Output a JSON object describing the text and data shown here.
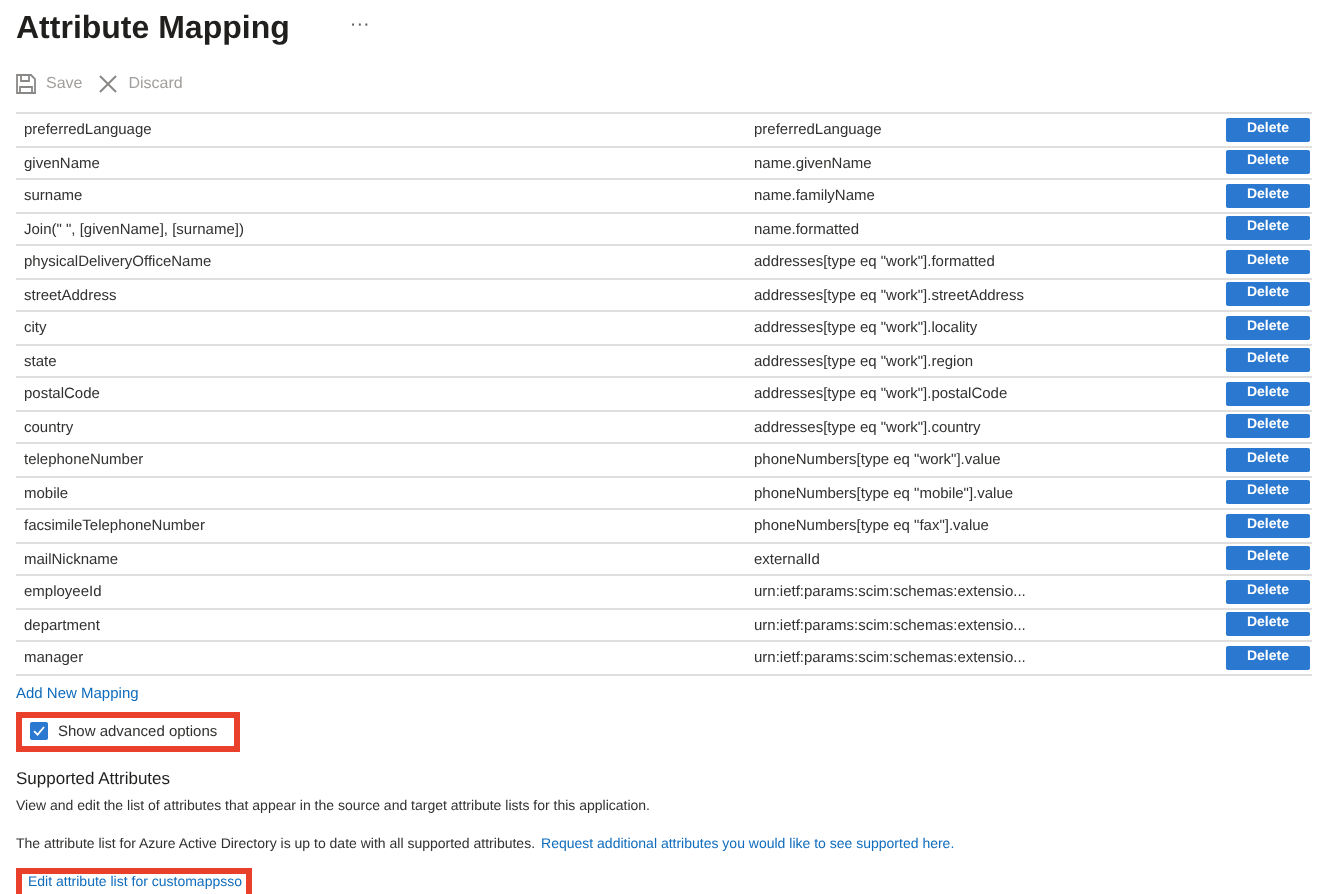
{
  "header": {
    "title": "Attribute Mapping",
    "more": "···"
  },
  "toolbar": [
    {
      "kind": "save",
      "label": "Save",
      "disabled": true
    },
    {
      "kind": "discard",
      "label": "Discard",
      "disabled": true
    }
  ],
  "mappings": [
    {
      "source": "preferredLanguage",
      "target": "preferredLanguage",
      "action": "Delete"
    },
    {
      "source": "givenName",
      "target": "name.givenName",
      "action": "Delete"
    },
    {
      "source": "surname",
      "target": "name.familyName",
      "action": "Delete"
    },
    {
      "source": "Join(\" \", [givenName], [surname])",
      "target": "name.formatted",
      "action": "Delete"
    },
    {
      "source": "physicalDeliveryOfficeName",
      "target": "addresses[type eq \"work\"].formatted",
      "action": "Delete"
    },
    {
      "source": "streetAddress",
      "target": "addresses[type eq \"work\"].streetAddress",
      "action": "Delete"
    },
    {
      "source": "city",
      "target": "addresses[type eq \"work\"].locality",
      "action": "Delete"
    },
    {
      "source": "state",
      "target": "addresses[type eq \"work\"].region",
      "action": "Delete"
    },
    {
      "source": "postalCode",
      "target": "addresses[type eq \"work\"].postalCode",
      "action": "Delete"
    },
    {
      "source": "country",
      "target": "addresses[type eq \"work\"].country",
      "action": "Delete"
    },
    {
      "source": "telephoneNumber",
      "target": "phoneNumbers[type eq \"work\"].value",
      "action": "Delete"
    },
    {
      "source": "mobile",
      "target": "phoneNumbers[type eq \"mobile\"].value",
      "action": "Delete"
    },
    {
      "source": "facsimileTelephoneNumber",
      "target": "phoneNumbers[type eq \"fax\"].value",
      "action": "Delete"
    },
    {
      "source": "mailNickname",
      "target": "externalId",
      "action": "Delete"
    },
    {
      "source": "employeeId",
      "target": "urn:ietf:params:scim:schemas:extensio...",
      "action": "Delete"
    },
    {
      "source": "department",
      "target": "urn:ietf:params:scim:schemas:extensio...",
      "action": "Delete"
    },
    {
      "source": "manager",
      "target": "urn:ietf:params:scim:schemas:extensio...",
      "action": "Delete"
    }
  ],
  "add_mapping": "Add New Mapping",
  "advanced": {
    "label": "Show advanced options",
    "checked": true,
    "highlighted": true
  },
  "supported": {
    "heading": "Supported Attributes",
    "description": "View and edit the list of attributes that appear in the source and target attribute lists for this application.",
    "status": "The attribute list for Azure Active Directory is up to date with all supported attributes.",
    "request_link": "Request additional attributes you would like to see supported here.",
    "edit_link": {
      "label": "Edit attribute list for customappsso",
      "highlighted": true
    }
  }
}
